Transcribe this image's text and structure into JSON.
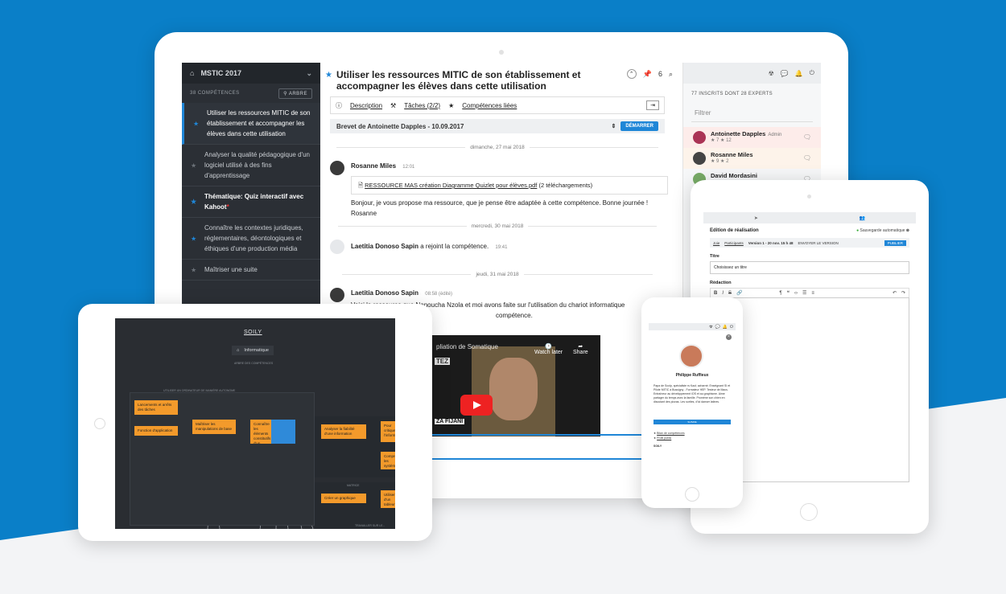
{
  "colors": {
    "brand_blue": "#0a7fc8",
    "accent": "#1f86d7",
    "sidebar": "#2b2f35",
    "node_orange": "#f39a2b"
  },
  "laptop": {
    "sidebar": {
      "title": "MSTIC 2017",
      "count": "38 COMPÉTENCES",
      "tree_button": "ARBRE",
      "items": [
        {
          "label": "Utiliser les ressources MITIC de son établissement et accompagner les élèves dans cette utilisation",
          "active": true
        },
        {
          "label": "Analyser la qualité pédagogique d'un logiciel utilisé à des fins d'apprentissage"
        },
        {
          "label": "Thématique: Quiz interactif avec Kahoot"
        },
        {
          "label": "Connaître les contextes juridiques, réglementaires, déontologiques et éthiques d'une production média"
        },
        {
          "label": "Maîtriser une suite"
        }
      ]
    },
    "main": {
      "title": "Utiliser les ressources MITIC de son établissement et accompagner les élèves dans cette utilisation",
      "pin_count": "6",
      "tabs": [
        "Description",
        "Tâches (2/2)",
        "Compétences liées"
      ],
      "brevet": "Brevet de Antoinette Dapples - 10.09.2017",
      "start_button": "DÉMARRER",
      "dates": [
        "dimanche, 27 mai 2018",
        "mercredi, 30 mai 2018",
        "jeudi, 31 mai 2018"
      ],
      "messages": [
        {
          "author": "Rosanne Miles",
          "time": "12:01",
          "attachment": "RESSOURCE MAS création Diagramme Quizlet pour élèves.pdf",
          "attachment_meta": "(2 téléchargements)",
          "text": "Bonjour, je vous propose ma ressource, que je pense être adaptée à cette compétence. Bonne journée ! Rosanne"
        },
        {
          "author": "Laetitia Donoso Sapin",
          "text": "a rejoint la compétence.",
          "time": "19:41"
        },
        {
          "author": "Laetitia Donoso Sapin",
          "time": "08:58 (édité)",
          "text": "Voici la ressource que Nanoucha Nzola et moi avons faite sur l'utilisation du chariot informatique",
          "text2": "compétence."
        }
      ],
      "video": {
        "watch_later": "Watch later",
        "share": "Share",
        "title": "pliation de Somatique",
        "caption": "ZA FIJANI",
        "caption2": "TEZ"
      }
    },
    "right_panel": {
      "members_count": "77 INSCRITS DONT 28 EXPERTS",
      "filter_placeholder": "Filtrer",
      "members": [
        {
          "name": "Antoinette Dapples",
          "role": "Admin",
          "score": "★ 7  ★ 12"
        },
        {
          "name": "Rosanne Miles",
          "score": "★ 9  ★ 2"
        },
        {
          "name": "David Mordasini",
          "score": ""
        }
      ]
    }
  },
  "tablet_right": {
    "title": "Edition de réalisation",
    "saved": "Sauvegarde automatique",
    "bar_items": [
      "Joie",
      "Participants",
      "Version 1 - 20 nov. 15 h 48",
      "ENVOYER LE VERSION",
      "PUBLIER"
    ],
    "label_title": "Titre",
    "title_value": "Choisissez un titre",
    "label_body": "Rédaction"
  },
  "phone": {
    "name": "Philippe Ruffieux",
    "bio": "Papa de Scolp, spécialiste rs Kaol; acharné; Enseignant SI et Pilote MITIC à Bussigny - Formateur HEP. Testeur de Macs. Entraîneur au développement iOS et au graphisme. Aime partager du temps avec la famille. Promène son chien en discutant des pizzas. Les sorties, d'ici danser latines.",
    "button": "SUIVRE",
    "links": [
      "Bilan de compétences",
      "Profil public"
    ],
    "footer": "SOILY"
  },
  "tablet_left": {
    "logo": "SOILY",
    "crumb": "Informatique",
    "subtitle": "ARBRE DES COMPÉTENCES",
    "frame_title": "UTILISER UN ORDINATEUR DE MANIÈRE AUTONOME",
    "frame2_title": "MATRICE",
    "frame3_title": "TRAVAILLER SUR LE...",
    "nodes": [
      "Lancements et arrêts des tâches",
      "Fonction d'application",
      "Maîtriser les manipulations de base",
      "Connaître les éléments constitutifs d'un ordinateur et",
      "Analyser la fiabilité d'une information",
      "Pour critiquer l'information",
      "Comprendre les systèmes",
      "Créer un graphique",
      "Utiliser d'un tableur"
    ]
  }
}
